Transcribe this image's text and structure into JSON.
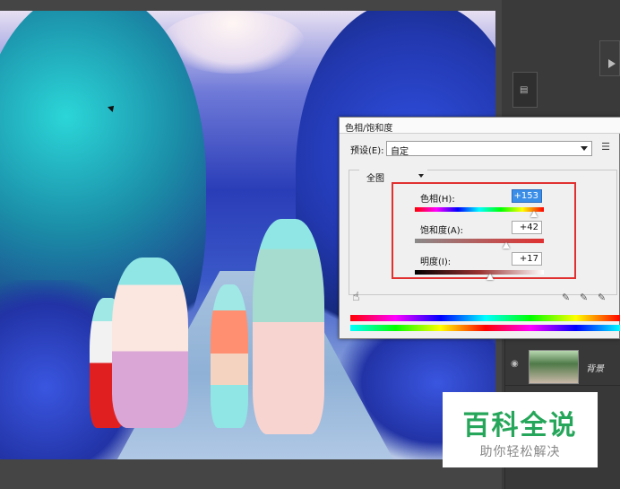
{
  "dialog": {
    "title": "色相/饱和度",
    "preset_label": "预设(E):",
    "preset_value": "自定",
    "preset_menu_icon": "menu-lines-icon",
    "channel_value": "全图",
    "hue": {
      "label": "色相(H):",
      "value": "+153",
      "position_fraction": 0.925
    },
    "saturation": {
      "label": "饱和度(A):",
      "value": "+42",
      "position_fraction": 0.71
    },
    "lightness": {
      "label": "明度(I):",
      "value": "+17",
      "position_fraction": 0.585
    },
    "tools": [
      "hand-adjust-icon",
      "eyedropper-icon",
      "eyedropper-plus-icon",
      "eyedropper-minus-icon"
    ]
  },
  "layers": {
    "items": [
      {
        "name": "背景",
        "visible": true
      }
    ]
  },
  "watermark": {
    "title": "百科全说",
    "subtitle": "助你轻松解决"
  },
  "colors": {
    "annotation": "#e03030",
    "watermark_green": "#26a65a",
    "selection": "#3b8ee8"
  }
}
